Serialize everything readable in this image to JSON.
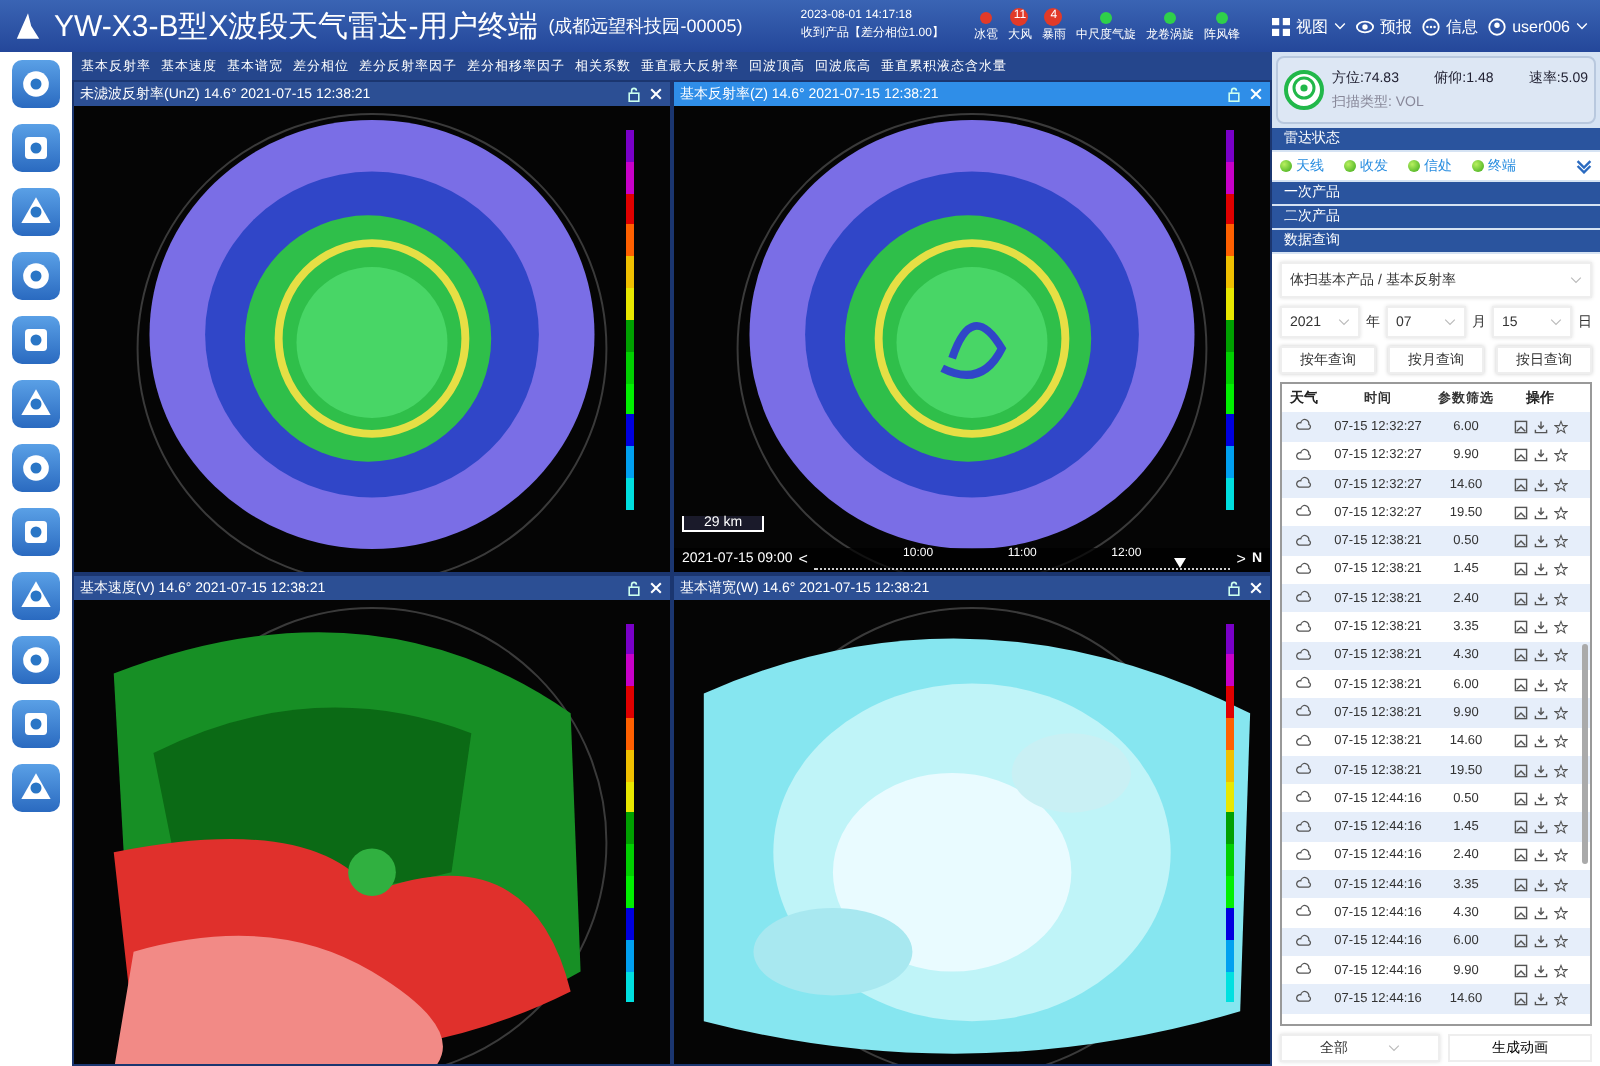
{
  "window": {
    "title": "YW-X3-B型X波段天气雷达-用户终端",
    "subtitle": "(成都远望科技园-00005)"
  },
  "header": {
    "datetime": "2023-08-01 14:17:18",
    "status": "收到产品【差分相位1.00】",
    "alerts": [
      {
        "label": "冰雹",
        "color": "#e23a28"
      },
      {
        "label": "大风",
        "count": "11",
        "color": "#e23a28"
      },
      {
        "label": "暴雨",
        "count": "4",
        "color": "#e23a28"
      },
      {
        "label": "中尺度气旋",
        "color": "#2fd04a"
      },
      {
        "label": "龙卷涡旋",
        "color": "#2fd04a"
      },
      {
        "label": "阵风锋",
        "color": "#2fd04a"
      }
    ],
    "menu": [
      {
        "label": "视图",
        "kind": "dropdown"
      },
      {
        "label": "预报",
        "kind": "forecast"
      },
      {
        "label": "信息",
        "kind": "info"
      },
      {
        "label": "user006",
        "kind": "user"
      }
    ]
  },
  "product_tabs": [
    "基本反射率",
    "基本速度",
    "基本谱宽",
    "差分相位",
    "差分反射率因子",
    "差分相移率因子",
    "相关系数",
    "垂直最大反射率",
    "回波顶高",
    "回波底高",
    "垂直累积液态含水量"
  ],
  "panels": [
    {
      "title": "未滤波反射率(UnZ) 14.6° 2021-07-15 12:38:21",
      "selected": false
    },
    {
      "title": "基本反射率(Z) 14.6° 2021-07-15 12:38:21",
      "selected": true
    },
    {
      "title": "基本速度(V) 14.6° 2021-07-15 12:38:21",
      "selected": false
    },
    {
      "title": "基本谱宽(W) 14.6° 2021-07-15 12:38:21",
      "selected": false
    }
  ],
  "map_overlay": {
    "scale": "29 km",
    "timeline": {
      "start": "2021-07-15 09:00",
      "prev": "<",
      "ticks": [
        "10:00",
        "11:00",
        "12:00"
      ],
      "level": 0.88,
      "next": ">",
      "north": "N"
    }
  },
  "sidebar": {
    "info": {
      "azimuth": "方位:74.83",
      "elevation": "俯仰:1.48",
      "speed": "速率:5.09",
      "scan": "扫描类型: VOL"
    },
    "status_title": "雷达状态",
    "status": [
      {
        "label": "天线",
        "on": true
      },
      {
        "label": "收发",
        "on": true
      },
      {
        "label": "信处",
        "on": true
      },
      {
        "label": "终端",
        "on": true
      }
    ],
    "sections": [
      "一次产品",
      "二次产品",
      "数据查询"
    ],
    "product_select": "体扫基本产品 / 基本反射率",
    "date": [
      {
        "value": "2021",
        "unit": "年"
      },
      {
        "value": "07",
        "unit": "月"
      },
      {
        "value": "15",
        "unit": "日"
      }
    ],
    "query_buttons": [
      "按年查询",
      "按月查询",
      "按日查询"
    ],
    "table": {
      "columns": [
        "天气",
        "时间",
        "参数筛选",
        "操作"
      ],
      "rows": [
        {
          "time": "07-15 12:32:27",
          "param": "6.00"
        },
        {
          "time": "07-15 12:32:27",
          "param": "9.90"
        },
        {
          "time": "07-15 12:32:27",
          "param": "14.60"
        },
        {
          "time": "07-15 12:32:27",
          "param": "19.50"
        },
        {
          "time": "07-15 12:38:21",
          "param": "0.50"
        },
        {
          "time": "07-15 12:38:21",
          "param": "1.45"
        },
        {
          "time": "07-15 12:38:21",
          "param": "2.40"
        },
        {
          "time": "07-15 12:38:21",
          "param": "3.35"
        },
        {
          "time": "07-15 12:38:21",
          "param": "4.30"
        },
        {
          "time": "07-15 12:38:21",
          "param": "6.00"
        },
        {
          "time": "07-15 12:38:21",
          "param": "9.90"
        },
        {
          "time": "07-15 12:38:21",
          "param": "14.60"
        },
        {
          "time": "07-15 12:38:21",
          "param": "19.50"
        },
        {
          "time": "07-15 12:44:16",
          "param": "0.50"
        },
        {
          "time": "07-15 12:44:16",
          "param": "1.45"
        },
        {
          "time": "07-15 12:44:16",
          "param": "2.40"
        },
        {
          "time": "07-15 12:44:16",
          "param": "3.35"
        },
        {
          "time": "07-15 12:44:16",
          "param": "4.30"
        },
        {
          "time": "07-15 12:44:16",
          "param": "6.00"
        },
        {
          "time": "07-15 12:44:16",
          "param": "9.90"
        },
        {
          "time": "07-15 12:44:16",
          "param": "14.60"
        }
      ]
    },
    "filter": "全部",
    "animate_button": "生成动画"
  }
}
